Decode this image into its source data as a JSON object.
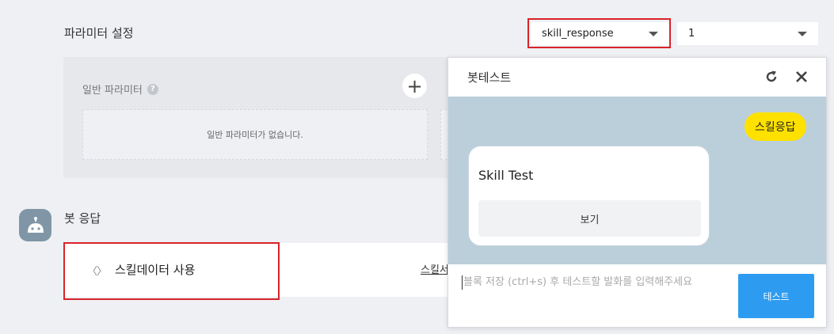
{
  "params": {
    "title": "파라미터 설정",
    "skill_select": "skill_response",
    "number_select": "1",
    "general_label": "일반 파라미터",
    "help_glyph": "?",
    "add_glyph": "+",
    "empty_text": "일반 파라미터가 없습니다."
  },
  "bot_response": {
    "label": "봇 응답",
    "chevron": "〈〉",
    "skill_data_label": "스킬데이터 사용",
    "skill_link": "스킬서버"
  },
  "bottest": {
    "title": "봇테스트",
    "user_message": "스킬응답",
    "card_title": "Skill Test",
    "card_button": "보기",
    "input_placeholder": "블록 저장 (ctrl+s) 후 테스트할 발화를 입력해주세요",
    "send_label": "테스트"
  },
  "colors": {
    "highlight": "#d8232a",
    "user_bubble": "#ffe100",
    "send_button": "#2d9cf0",
    "chat_bg": "#bbcfdb"
  },
  "icons": [
    "refresh-icon",
    "close-icon",
    "help-icon",
    "add-icon",
    "bot-icon",
    "chevron-down-icon"
  ]
}
